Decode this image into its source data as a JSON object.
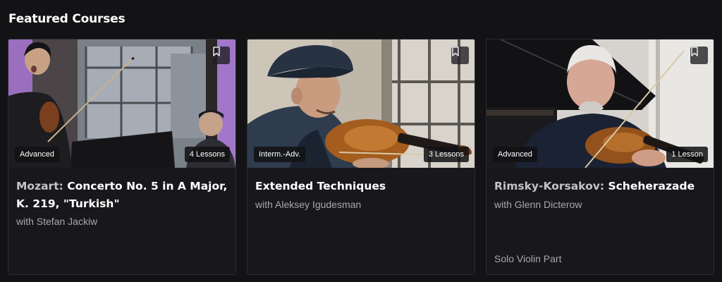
{
  "section": {
    "title": "Featured Courses"
  },
  "courses": [
    {
      "composer": "Mozart:",
      "title": "Concerto No. 5 in A Major, K. 219, \"Turkish\"",
      "instructor": "with Stefan Jackiw",
      "level": "Advanced",
      "lessons": "4 Lessons",
      "note": "",
      "thumbnail_icon": "violinist-performing-with-pianist-image"
    },
    {
      "composer": "",
      "title": "Extended Techniques",
      "instructor": "with Aleksey Igudesman",
      "level": "Interm.-Adv.",
      "lessons": "3 Lessons",
      "note": "",
      "thumbnail_icon": "violinist-in-cap-image"
    },
    {
      "composer": "Rimsky-Korsakov:",
      "title": "Scheherazade",
      "instructor": "with Glenn Dicterow",
      "level": "Advanced",
      "lessons": "1 Lesson",
      "note": "Solo Violin Part",
      "thumbnail_icon": "violinist-by-piano-image"
    }
  ],
  "icons": {
    "bookmark": "bookmark-icon"
  },
  "colors": {
    "background": "#131316",
    "card": "#18181c",
    "composer_text": "#c4c4c8",
    "secondary_text": "#a7a7ad"
  }
}
